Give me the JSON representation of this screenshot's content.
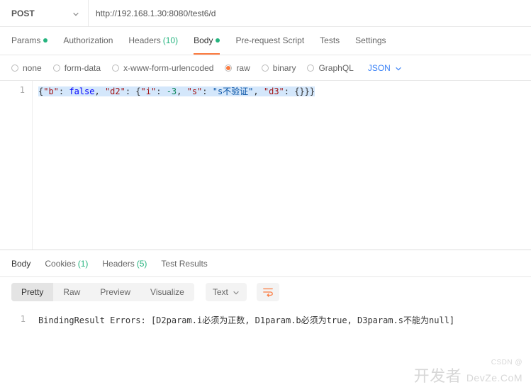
{
  "request": {
    "method": "POST",
    "url": "http://192.168.1.30:8080/test6/d"
  },
  "tabs": {
    "params": {
      "label": "Params",
      "has_dot": true
    },
    "authorization": {
      "label": "Authorization"
    },
    "headers": {
      "label": "Headers",
      "count": "(10)"
    },
    "body": {
      "label": "Body",
      "has_dot": true,
      "active": true
    },
    "prerequest": {
      "label": "Pre-request Script"
    },
    "tests": {
      "label": "Tests"
    },
    "settings": {
      "label": "Settings"
    }
  },
  "body_types": {
    "none": "none",
    "form_data": "form-data",
    "urlencoded": "x-www-form-urlencoded",
    "raw": "raw",
    "binary": "binary",
    "graphql": "GraphQL",
    "selected": "raw",
    "format": "JSON"
  },
  "request_body": {
    "line_no": "1",
    "raw": "{\"b\": false, \"d2\": {\"i\": -3, \"s\": \"s不验证\", \"d3\": {}}}",
    "tokens": [
      {
        "t": "{",
        "c": ""
      },
      {
        "t": "\"b\"",
        "c": "key"
      },
      {
        "t": ": ",
        "c": ""
      },
      {
        "t": "false",
        "c": "bool"
      },
      {
        "t": ", ",
        "c": ""
      },
      {
        "t": "\"d2\"",
        "c": "key"
      },
      {
        "t": ": {",
        "c": ""
      },
      {
        "t": "\"i\"",
        "c": "key"
      },
      {
        "t": ": ",
        "c": ""
      },
      {
        "t": "-3",
        "c": "num"
      },
      {
        "t": ", ",
        "c": ""
      },
      {
        "t": "\"s\"",
        "c": "key"
      },
      {
        "t": ": ",
        "c": ""
      },
      {
        "t": "\"s不验证\"",
        "c": "str"
      },
      {
        "t": ", ",
        "c": ""
      },
      {
        "t": "\"d3\"",
        "c": "key"
      },
      {
        "t": ": {}}}",
        "c": ""
      }
    ]
  },
  "response": {
    "tabs": {
      "body": {
        "label": "Body",
        "active": true
      },
      "cookies": {
        "label": "Cookies",
        "count": "(1)"
      },
      "headers": {
        "label": "Headers",
        "count": "(5)"
      },
      "test_results": {
        "label": "Test Results"
      }
    },
    "views": {
      "pretty": "Pretty",
      "raw": "Raw",
      "preview": "Preview",
      "visualize": "Visualize",
      "selected": "pretty",
      "format": "Text"
    },
    "body": {
      "line_no": "1",
      "text": "BindingResult Errors: [D2param.i必须为正数, D1param.b必须为true, D3param.s不能为null]"
    }
  },
  "watermark": {
    "top": "CSDN @",
    "main": "开发者",
    "suffix": "DevZe.CoM"
  }
}
